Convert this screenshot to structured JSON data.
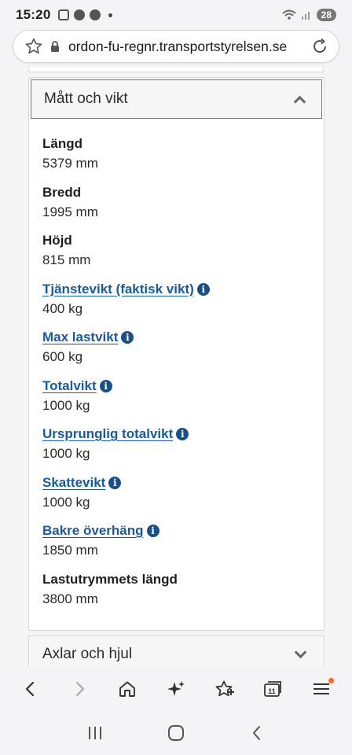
{
  "status_bar": {
    "time": "15:20",
    "battery": "28",
    "icons": [
      "screenshot-icon",
      "facebook-icon",
      "messenger-icon",
      "wifi-icon",
      "signal-icon"
    ]
  },
  "browser": {
    "url": "ordon-fu-regnr.transportstyrelsen.se",
    "toolbar_icons": [
      "back-icon",
      "forward-icon",
      "home-icon",
      "sparkle-icon",
      "bookmark-star-icon",
      "tabs-icon",
      "menu-icon"
    ],
    "tab_count": "11"
  },
  "section": {
    "title": "Mått och vikt",
    "items": [
      {
        "label": "Längd",
        "value": "5379 mm",
        "link": false
      },
      {
        "label": "Bredd",
        "value": "1995 mm",
        "link": false
      },
      {
        "label": "Höjd",
        "value": "815 mm",
        "link": false
      },
      {
        "label": "Tjänstevikt (faktisk vikt)",
        "value": "400 kg",
        "link": true
      },
      {
        "label": "Max lastvikt",
        "value": "600 kg",
        "link": true
      },
      {
        "label": "Totalvikt",
        "value": "1000 kg",
        "link": true
      },
      {
        "label": "Ursprunglig totalvikt",
        "value": "1000 kg",
        "link": true
      },
      {
        "label": "Skattevikt",
        "value": "1000 kg",
        "link": true
      },
      {
        "label": "Bakre överhäng",
        "value": "1850 mm",
        "link": true
      },
      {
        "label": "Lastutrymmets längd",
        "value": "3800 mm",
        "link": false
      }
    ]
  },
  "next_section": {
    "title": "Axlar och hjul"
  },
  "info_icon_glyph": "i",
  "colors": {
    "link": "#1a5a9a",
    "info_icon": "#1a4f86",
    "notification": "#ff6a2b"
  }
}
